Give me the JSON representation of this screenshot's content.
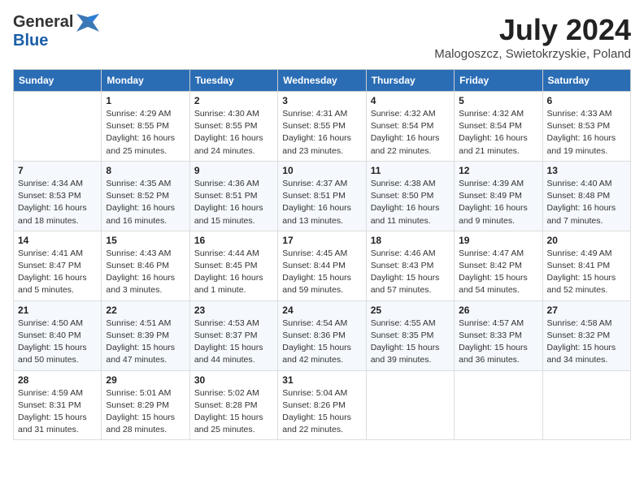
{
  "header": {
    "logo_general": "General",
    "logo_blue": "Blue",
    "month_title": "July 2024",
    "location": "Malogoszcz, Swietokrzyskie, Poland"
  },
  "calendar": {
    "days_of_week": [
      "Sunday",
      "Monday",
      "Tuesday",
      "Wednesday",
      "Thursday",
      "Friday",
      "Saturday"
    ],
    "weeks": [
      [
        {
          "day": "",
          "info": ""
        },
        {
          "day": "1",
          "info": "Sunrise: 4:29 AM\nSunset: 8:55 PM\nDaylight: 16 hours\nand 25 minutes."
        },
        {
          "day": "2",
          "info": "Sunrise: 4:30 AM\nSunset: 8:55 PM\nDaylight: 16 hours\nand 24 minutes."
        },
        {
          "day": "3",
          "info": "Sunrise: 4:31 AM\nSunset: 8:55 PM\nDaylight: 16 hours\nand 23 minutes."
        },
        {
          "day": "4",
          "info": "Sunrise: 4:32 AM\nSunset: 8:54 PM\nDaylight: 16 hours\nand 22 minutes."
        },
        {
          "day": "5",
          "info": "Sunrise: 4:32 AM\nSunset: 8:54 PM\nDaylight: 16 hours\nand 21 minutes."
        },
        {
          "day": "6",
          "info": "Sunrise: 4:33 AM\nSunset: 8:53 PM\nDaylight: 16 hours\nand 19 minutes."
        }
      ],
      [
        {
          "day": "7",
          "info": "Sunrise: 4:34 AM\nSunset: 8:53 PM\nDaylight: 16 hours\nand 18 minutes."
        },
        {
          "day": "8",
          "info": "Sunrise: 4:35 AM\nSunset: 8:52 PM\nDaylight: 16 hours\nand 16 minutes."
        },
        {
          "day": "9",
          "info": "Sunrise: 4:36 AM\nSunset: 8:51 PM\nDaylight: 16 hours\nand 15 minutes."
        },
        {
          "day": "10",
          "info": "Sunrise: 4:37 AM\nSunset: 8:51 PM\nDaylight: 16 hours\nand 13 minutes."
        },
        {
          "day": "11",
          "info": "Sunrise: 4:38 AM\nSunset: 8:50 PM\nDaylight: 16 hours\nand 11 minutes."
        },
        {
          "day": "12",
          "info": "Sunrise: 4:39 AM\nSunset: 8:49 PM\nDaylight: 16 hours\nand 9 minutes."
        },
        {
          "day": "13",
          "info": "Sunrise: 4:40 AM\nSunset: 8:48 PM\nDaylight: 16 hours\nand 7 minutes."
        }
      ],
      [
        {
          "day": "14",
          "info": "Sunrise: 4:41 AM\nSunset: 8:47 PM\nDaylight: 16 hours\nand 5 minutes."
        },
        {
          "day": "15",
          "info": "Sunrise: 4:43 AM\nSunset: 8:46 PM\nDaylight: 16 hours\nand 3 minutes."
        },
        {
          "day": "16",
          "info": "Sunrise: 4:44 AM\nSunset: 8:45 PM\nDaylight: 16 hours\nand 1 minute."
        },
        {
          "day": "17",
          "info": "Sunrise: 4:45 AM\nSunset: 8:44 PM\nDaylight: 15 hours\nand 59 minutes."
        },
        {
          "day": "18",
          "info": "Sunrise: 4:46 AM\nSunset: 8:43 PM\nDaylight: 15 hours\nand 57 minutes."
        },
        {
          "day": "19",
          "info": "Sunrise: 4:47 AM\nSunset: 8:42 PM\nDaylight: 15 hours\nand 54 minutes."
        },
        {
          "day": "20",
          "info": "Sunrise: 4:49 AM\nSunset: 8:41 PM\nDaylight: 15 hours\nand 52 minutes."
        }
      ],
      [
        {
          "day": "21",
          "info": "Sunrise: 4:50 AM\nSunset: 8:40 PM\nDaylight: 15 hours\nand 50 minutes."
        },
        {
          "day": "22",
          "info": "Sunrise: 4:51 AM\nSunset: 8:39 PM\nDaylight: 15 hours\nand 47 minutes."
        },
        {
          "day": "23",
          "info": "Sunrise: 4:53 AM\nSunset: 8:37 PM\nDaylight: 15 hours\nand 44 minutes."
        },
        {
          "day": "24",
          "info": "Sunrise: 4:54 AM\nSunset: 8:36 PM\nDaylight: 15 hours\nand 42 minutes."
        },
        {
          "day": "25",
          "info": "Sunrise: 4:55 AM\nSunset: 8:35 PM\nDaylight: 15 hours\nand 39 minutes."
        },
        {
          "day": "26",
          "info": "Sunrise: 4:57 AM\nSunset: 8:33 PM\nDaylight: 15 hours\nand 36 minutes."
        },
        {
          "day": "27",
          "info": "Sunrise: 4:58 AM\nSunset: 8:32 PM\nDaylight: 15 hours\nand 34 minutes."
        }
      ],
      [
        {
          "day": "28",
          "info": "Sunrise: 4:59 AM\nSunset: 8:31 PM\nDaylight: 15 hours\nand 31 minutes."
        },
        {
          "day": "29",
          "info": "Sunrise: 5:01 AM\nSunset: 8:29 PM\nDaylight: 15 hours\nand 28 minutes."
        },
        {
          "day": "30",
          "info": "Sunrise: 5:02 AM\nSunset: 8:28 PM\nDaylight: 15 hours\nand 25 minutes."
        },
        {
          "day": "31",
          "info": "Sunrise: 5:04 AM\nSunset: 8:26 PM\nDaylight: 15 hours\nand 22 minutes."
        },
        {
          "day": "",
          "info": ""
        },
        {
          "day": "",
          "info": ""
        },
        {
          "day": "",
          "info": ""
        }
      ]
    ]
  }
}
